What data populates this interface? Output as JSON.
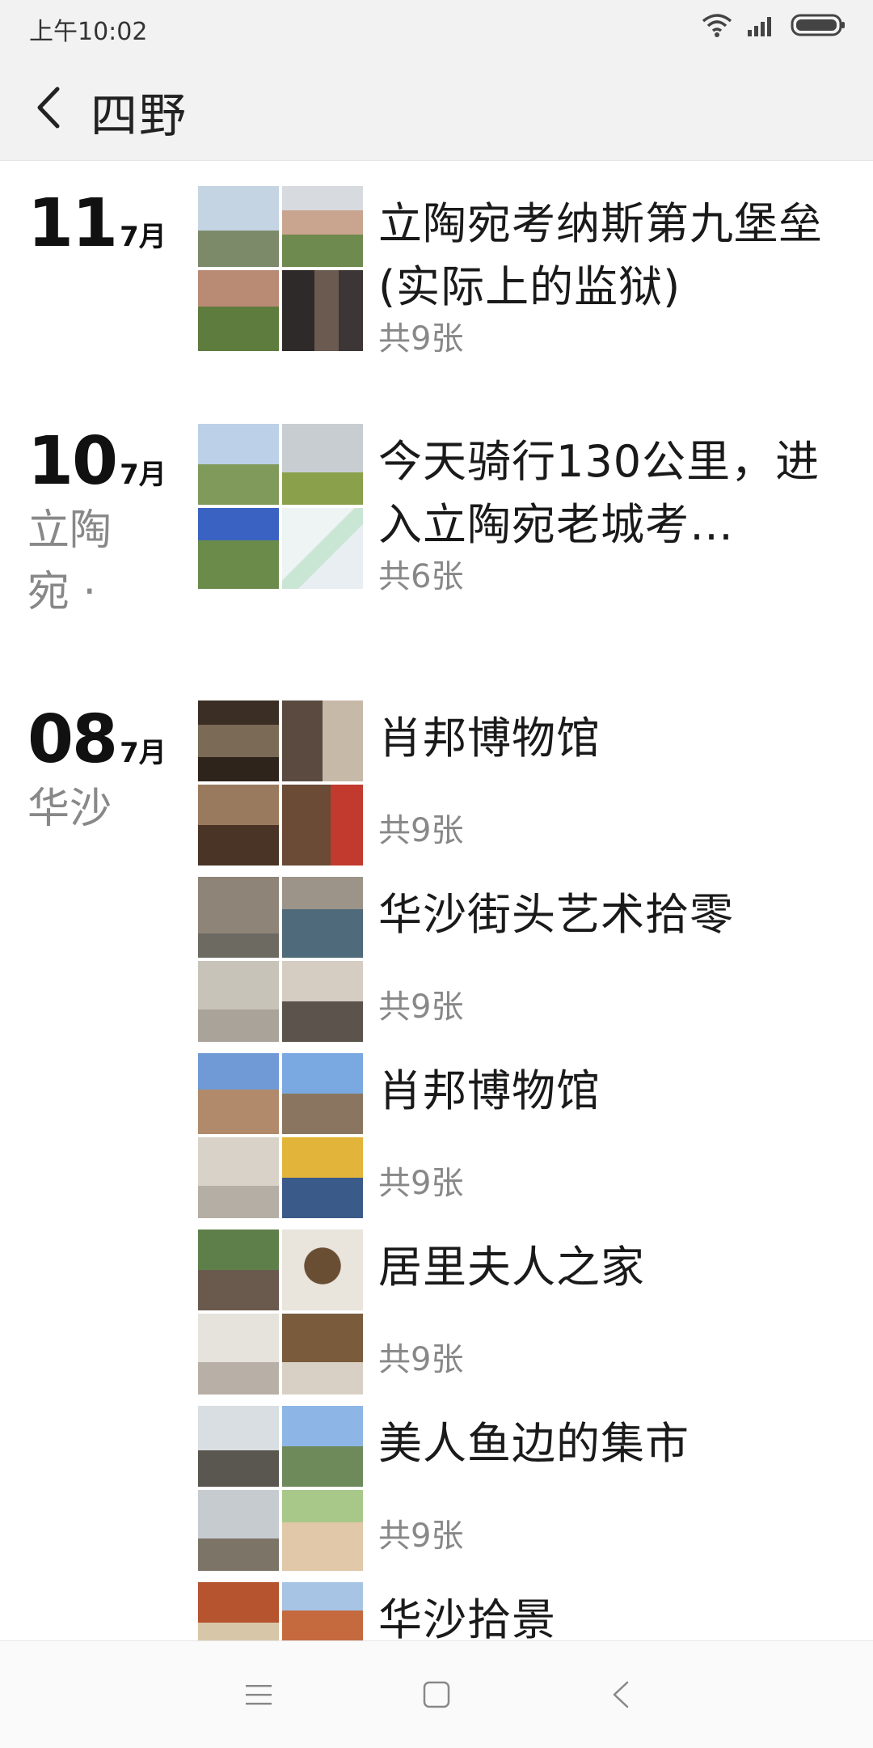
{
  "status_bar": {
    "time": "上午10:02",
    "icons": [
      "wifi-icon",
      "signal-icon",
      "battery-icon"
    ]
  },
  "header": {
    "back_icon": "chevron-left-icon",
    "title": "四野"
  },
  "groups": [
    {
      "day": "11",
      "month": "7月",
      "location": "",
      "posts": [
        {
          "title": "立陶宛考纳斯第九堡垒(实际上的监狱)",
          "count": "共9张"
        }
      ]
    },
    {
      "day": "10",
      "month": "7月",
      "location": "立陶宛 ·",
      "posts": [
        {
          "title": "今天骑行130公里，进入立陶宛老城考…",
          "count": "共6张"
        }
      ]
    },
    {
      "day": "08",
      "month": "7月",
      "location": "华沙",
      "posts": [
        {
          "title": "肖邦博物馆",
          "count": "共9张"
        },
        {
          "title": "华沙街头艺术拾零",
          "count": "共9张"
        },
        {
          "title": "肖邦博物馆",
          "count": "共9张"
        },
        {
          "title": "居里夫人之家",
          "count": "共9张"
        },
        {
          "title": "美人鱼边的集市",
          "count": "共9张"
        },
        {
          "title": "华沙拾景",
          "count": ""
        }
      ]
    }
  ],
  "nav_bar": {
    "icons": [
      "menu-icon",
      "home-square-icon",
      "back-triangle-icon"
    ]
  }
}
